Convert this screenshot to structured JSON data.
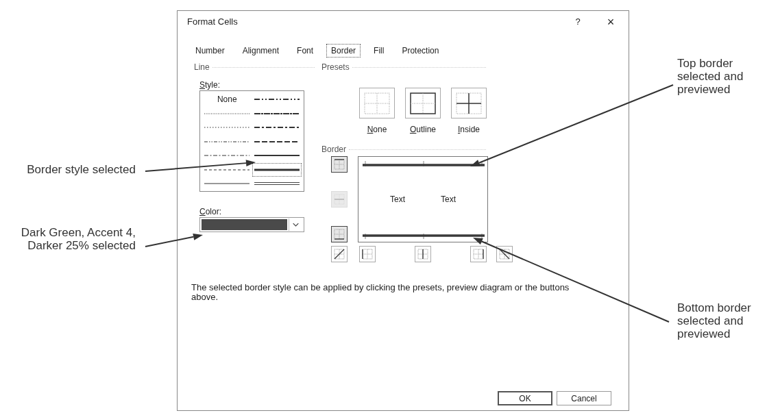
{
  "window": {
    "title": "Format Cells",
    "help": "?",
    "close": "×"
  },
  "tabs": [
    {
      "label": "Number",
      "selected": false
    },
    {
      "label": "Alignment",
      "selected": false
    },
    {
      "label": "Font",
      "selected": false
    },
    {
      "label": "Border",
      "selected": true
    },
    {
      "label": "Fill",
      "selected": false
    },
    {
      "label": "Protection",
      "selected": false
    }
  ],
  "line": {
    "heading": "Line",
    "style_label": "Style:",
    "styles": [
      {
        "kind": "none",
        "label": "None",
        "selected": false
      },
      {
        "kind": "medium-dash-dot-dot",
        "selected": false
      },
      {
        "kind": "hair",
        "selected": false
      },
      {
        "kind": "slant-dash-dot",
        "selected": false
      },
      {
        "kind": "dotted",
        "selected": false
      },
      {
        "kind": "medium-dash-dot",
        "selected": false
      },
      {
        "kind": "dash-dot-dot",
        "selected": false
      },
      {
        "kind": "medium-dashed",
        "selected": false
      },
      {
        "kind": "dash-dot",
        "selected": false
      },
      {
        "kind": "medium",
        "selected": false
      },
      {
        "kind": "dashed",
        "selected": false
      },
      {
        "kind": "thick",
        "selected": true
      },
      {
        "kind": "thin",
        "selected": false
      },
      {
        "kind": "double",
        "selected": false
      }
    ],
    "color_label": "Color:"
  },
  "presets": {
    "heading": "Presets",
    "items": [
      {
        "kind": "none",
        "label": "None"
      },
      {
        "kind": "outline",
        "label": "Outline"
      },
      {
        "kind": "inside",
        "label": "Inside"
      }
    ]
  },
  "border": {
    "heading": "Border",
    "buttons": [
      {
        "kind": "top",
        "pressed": true,
        "disabled": false
      },
      {
        "kind": "middle-horizontal",
        "pressed": false,
        "disabled": true
      },
      {
        "kind": "bottom",
        "pressed": true,
        "disabled": false
      },
      {
        "kind": "diagonal-up",
        "pressed": false,
        "disabled": false
      },
      {
        "kind": "left",
        "pressed": false,
        "disabled": false
      },
      {
        "kind": "middle-vertical",
        "pressed": false,
        "disabled": false
      },
      {
        "kind": "right",
        "pressed": false,
        "disabled": false
      },
      {
        "kind": "diagonal-down",
        "pressed": false,
        "disabled": false
      }
    ],
    "preview_texts": [
      "Text",
      "Text"
    ]
  },
  "description": "The selected border style can be applied by clicking the presets, preview diagram or the buttons above.",
  "buttons": [
    {
      "label": "OK",
      "default": true
    },
    {
      "label": "Cancel",
      "default": false
    }
  ],
  "callouts": [
    {
      "text": "Border style selected"
    },
    {
      "text": "Dark Green, Accent 4, Darker 25% selected"
    },
    {
      "text": "Top border selected and previewed"
    },
    {
      "text": "Bottom border selected and previewed"
    }
  ]
}
